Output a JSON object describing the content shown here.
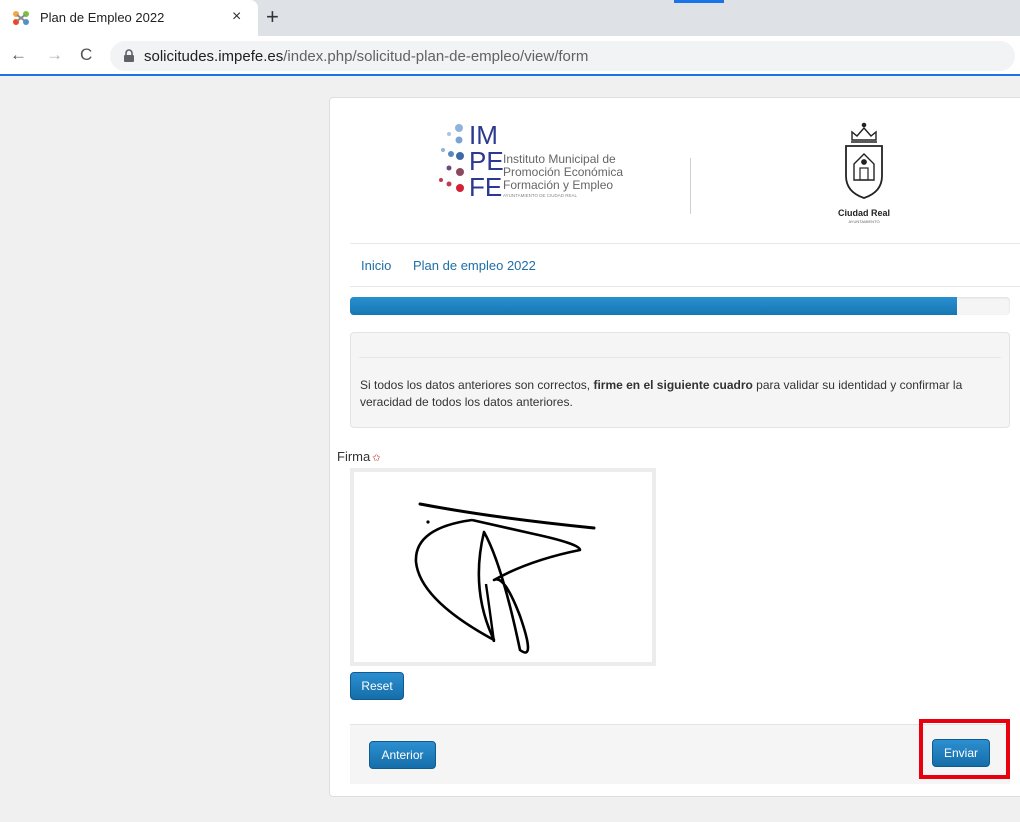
{
  "browser": {
    "tab_title": "Plan de Empleo 2022",
    "tab_close": "×",
    "new_tab": "+",
    "back": "←",
    "forward": "→",
    "reload": "C",
    "url_host": "solicitudes.impefe.es",
    "url_path": "/index.php/solicitud-plan-de-empleo/view/form"
  },
  "logos": {
    "impefe_letters": [
      "IM",
      "PE",
      "FE"
    ],
    "impefe_lines": [
      "Instituto Municipal de",
      "Promoción Económica",
      "Formación y Empleo"
    ],
    "impefe_sub": "AYUNTAMIENTO DE CIUDAD REAL",
    "ciudad_name": "Ciudad Real",
    "ciudad_sub": "AYUNTAMIENTO"
  },
  "breadcrumb": {
    "home": "Inicio",
    "current": "Plan de empleo 2022"
  },
  "progress": {
    "percent": 92
  },
  "notice": {
    "text_before": "Si todos los datos anteriores son correctos, ",
    "text_bold": "firme en el siguiente cuadro",
    "text_after": " para validar su identidad y confirmar la veracidad de todos los datos anteriores."
  },
  "signature": {
    "label": "Firma",
    "required_mark": "✩",
    "reset_label": "Reset"
  },
  "footer": {
    "prev_label": "Anterior",
    "submit_label": "Enviar"
  },
  "colors": {
    "accent": "#1b7fbd",
    "highlight": "#e8000d",
    "link": "#1e6ea7"
  }
}
